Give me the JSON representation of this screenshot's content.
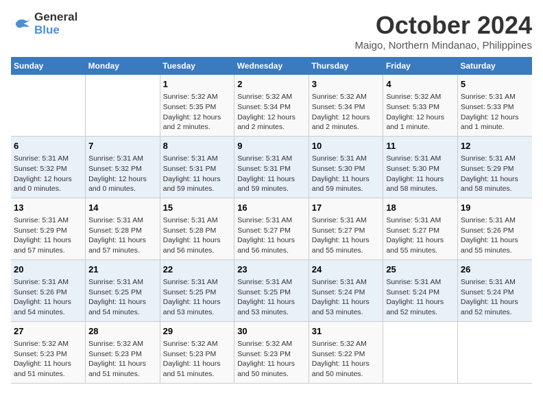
{
  "logo": {
    "line1": "General",
    "line2": "Blue"
  },
  "title": "October 2024",
  "subtitle": "Maigo, Northern Mindanao, Philippines",
  "weekdays": [
    "Sunday",
    "Monday",
    "Tuesday",
    "Wednesday",
    "Thursday",
    "Friday",
    "Saturday"
  ],
  "weeks": [
    [
      {
        "day": "",
        "info": ""
      },
      {
        "day": "",
        "info": ""
      },
      {
        "day": "1",
        "info": "Sunrise: 5:32 AM\nSunset: 5:35 PM\nDaylight: 12 hours\nand 2 minutes."
      },
      {
        "day": "2",
        "info": "Sunrise: 5:32 AM\nSunset: 5:34 PM\nDaylight: 12 hours\nand 2 minutes."
      },
      {
        "day": "3",
        "info": "Sunrise: 5:32 AM\nSunset: 5:34 PM\nDaylight: 12 hours\nand 2 minutes."
      },
      {
        "day": "4",
        "info": "Sunrise: 5:32 AM\nSunset: 5:33 PM\nDaylight: 12 hours\nand 1 minute."
      },
      {
        "day": "5",
        "info": "Sunrise: 5:31 AM\nSunset: 5:33 PM\nDaylight: 12 hours\nand 1 minute."
      }
    ],
    [
      {
        "day": "6",
        "info": "Sunrise: 5:31 AM\nSunset: 5:32 PM\nDaylight: 12 hours\nand 0 minutes."
      },
      {
        "day": "7",
        "info": "Sunrise: 5:31 AM\nSunset: 5:32 PM\nDaylight: 12 hours\nand 0 minutes."
      },
      {
        "day": "8",
        "info": "Sunrise: 5:31 AM\nSunset: 5:31 PM\nDaylight: 11 hours\nand 59 minutes."
      },
      {
        "day": "9",
        "info": "Sunrise: 5:31 AM\nSunset: 5:31 PM\nDaylight: 11 hours\nand 59 minutes."
      },
      {
        "day": "10",
        "info": "Sunrise: 5:31 AM\nSunset: 5:30 PM\nDaylight: 11 hours\nand 59 minutes."
      },
      {
        "day": "11",
        "info": "Sunrise: 5:31 AM\nSunset: 5:30 PM\nDaylight: 11 hours\nand 58 minutes."
      },
      {
        "day": "12",
        "info": "Sunrise: 5:31 AM\nSunset: 5:29 PM\nDaylight: 11 hours\nand 58 minutes."
      }
    ],
    [
      {
        "day": "13",
        "info": "Sunrise: 5:31 AM\nSunset: 5:29 PM\nDaylight: 11 hours\nand 57 minutes."
      },
      {
        "day": "14",
        "info": "Sunrise: 5:31 AM\nSunset: 5:28 PM\nDaylight: 11 hours\nand 57 minutes."
      },
      {
        "day": "15",
        "info": "Sunrise: 5:31 AM\nSunset: 5:28 PM\nDaylight: 11 hours\nand 56 minutes."
      },
      {
        "day": "16",
        "info": "Sunrise: 5:31 AM\nSunset: 5:27 PM\nDaylight: 11 hours\nand 56 minutes."
      },
      {
        "day": "17",
        "info": "Sunrise: 5:31 AM\nSunset: 5:27 PM\nDaylight: 11 hours\nand 55 minutes."
      },
      {
        "day": "18",
        "info": "Sunrise: 5:31 AM\nSunset: 5:27 PM\nDaylight: 11 hours\nand 55 minutes."
      },
      {
        "day": "19",
        "info": "Sunrise: 5:31 AM\nSunset: 5:26 PM\nDaylight: 11 hours\nand 55 minutes."
      }
    ],
    [
      {
        "day": "20",
        "info": "Sunrise: 5:31 AM\nSunset: 5:26 PM\nDaylight: 11 hours\nand 54 minutes."
      },
      {
        "day": "21",
        "info": "Sunrise: 5:31 AM\nSunset: 5:25 PM\nDaylight: 11 hours\nand 54 minutes."
      },
      {
        "day": "22",
        "info": "Sunrise: 5:31 AM\nSunset: 5:25 PM\nDaylight: 11 hours\nand 53 minutes."
      },
      {
        "day": "23",
        "info": "Sunrise: 5:31 AM\nSunset: 5:25 PM\nDaylight: 11 hours\nand 53 minutes."
      },
      {
        "day": "24",
        "info": "Sunrise: 5:31 AM\nSunset: 5:24 PM\nDaylight: 11 hours\nand 53 minutes."
      },
      {
        "day": "25",
        "info": "Sunrise: 5:31 AM\nSunset: 5:24 PM\nDaylight: 11 hours\nand 52 minutes."
      },
      {
        "day": "26",
        "info": "Sunrise: 5:31 AM\nSunset: 5:24 PM\nDaylight: 11 hours\nand 52 minutes."
      }
    ],
    [
      {
        "day": "27",
        "info": "Sunrise: 5:32 AM\nSunset: 5:23 PM\nDaylight: 11 hours\nand 51 minutes."
      },
      {
        "day": "28",
        "info": "Sunrise: 5:32 AM\nSunset: 5:23 PM\nDaylight: 11 hours\nand 51 minutes."
      },
      {
        "day": "29",
        "info": "Sunrise: 5:32 AM\nSunset: 5:23 PM\nDaylight: 11 hours\nand 51 minutes."
      },
      {
        "day": "30",
        "info": "Sunrise: 5:32 AM\nSunset: 5:23 PM\nDaylight: 11 hours\nand 50 minutes."
      },
      {
        "day": "31",
        "info": "Sunrise: 5:32 AM\nSunset: 5:22 PM\nDaylight: 11 hours\nand 50 minutes."
      },
      {
        "day": "",
        "info": ""
      },
      {
        "day": "",
        "info": ""
      }
    ]
  ]
}
